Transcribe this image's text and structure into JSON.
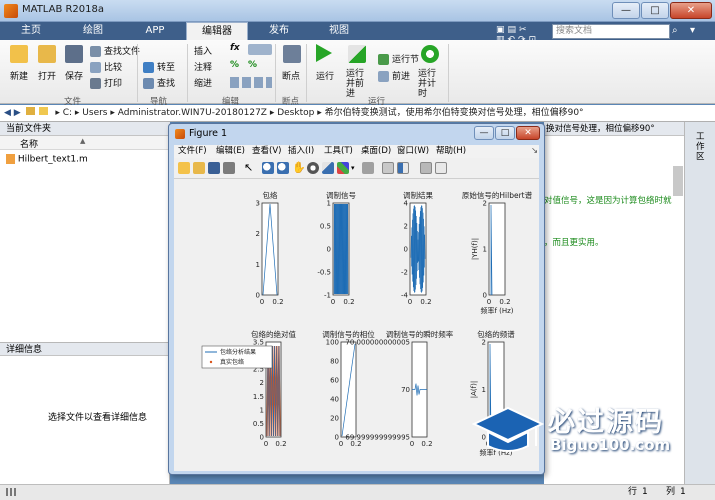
{
  "window": {
    "title": "MATLAB R2018a",
    "controls": [
      "—",
      "□",
      "✕"
    ]
  },
  "ribbon_tabs": [
    "主页",
    "绘图",
    "APP",
    "编辑器",
    "发布",
    "视图"
  ],
  "active_tab": "编辑器",
  "search": {
    "placeholder": "搜索文档"
  },
  "ribbon": {
    "file_buttons": [
      "新建",
      "打开",
      "保存"
    ],
    "file_small": [
      "查找文件",
      "比较",
      "打印"
    ],
    "nav_small": [
      "转至",
      "查找"
    ],
    "edit_small_1": [
      "插入",
      "注释",
      "缩进"
    ],
    "edit_symbols": [
      "fx",
      "%",
      "%"
    ],
    "breakpoint": "断点",
    "run_buttons": [
      "运行",
      "运行并前进",
      "运行节",
      "前进",
      "运行并计时"
    ],
    "groups": [
      "文件",
      "导航",
      "编辑",
      "断点",
      "运行"
    ]
  },
  "address": {
    "path": [
      "C:",
      "Users",
      "Administrator.WIN7U-20180127Z",
      "Desktop",
      "希尔伯特变换测试，使用希尔伯特变换对信号处理，相位偏移90°"
    ]
  },
  "left_panel": {
    "current_folder": "当前文件夹",
    "column_name": "名称",
    "column_sort": "▲",
    "files": [
      "Hilbert_text1.m"
    ],
    "details_header": "详细信息",
    "details_hint": "选择文件以查看详细信息"
  },
  "editor_panel": {
    "title_text": "换对信号处理，相位偏移90°",
    "line1": "对值信号，这是因为计算包络时就",
    "line2": "，而且更实用。",
    "workspace_label": "工作区"
  },
  "status": {
    "row_label": "行",
    "row": "1",
    "col_label": "列",
    "col": "1"
  },
  "figure": {
    "title": "Figure 1",
    "menu": [
      "文件(F)",
      "编辑(E)",
      "查看(V)",
      "插入(I)",
      "工具(T)",
      "桌面(D)",
      "窗口(W)",
      "帮助(H)"
    ],
    "plots": [
      {
        "title": "包络",
        "yticks": [
          "3",
          "2",
          "1",
          "0"
        ],
        "xticks": [
          "0",
          "0.2"
        ]
      },
      {
        "title": "调制信号",
        "yticks": [
          "1",
          "0.5",
          "0",
          "-0.5",
          "-1"
        ],
        "xticks": [
          "0",
          "0.2"
        ]
      },
      {
        "title": "调制结果",
        "yticks": [
          "4",
          "2",
          "0",
          "-2",
          "-4"
        ],
        "xticks": [
          "0",
          "0.2"
        ]
      },
      {
        "title": "原始信号的Hilbert谱",
        "yticks": [
          "2",
          "1",
          "0"
        ],
        "xticks": [
          "0",
          "0.2"
        ],
        "ylabel": "|YH(f)|",
        "xlabel": "频率f (Hz)"
      },
      {
        "title": "包络的绝对值",
        "yticks": [
          "3.5",
          "3",
          "2.5",
          "2",
          "1.5",
          "1",
          "0.5",
          "0"
        ],
        "xticks": [
          "0",
          "0.2"
        ]
      },
      {
        "title": "调制信号的相位",
        "yticks": [
          "100",
          "80",
          "60",
          "40",
          "20",
          "0"
        ],
        "xticks": [
          "0",
          "0.2"
        ]
      },
      {
        "title": "调制信号的瞬时频率",
        "yticks": [
          "70.000000000005",
          "70",
          "69.999999999995"
        ],
        "xticks": [
          "0",
          "0.2"
        ]
      },
      {
        "title": "包络的频谱",
        "yticks": [
          "2",
          "1",
          "0"
        ],
        "xticks": [
          "0",
          "0.2"
        ],
        "ylabel": "|A(f)|",
        "xlabel": "频率f (Hz)"
      }
    ],
    "legend": [
      "包络分析结果",
      "真实包络"
    ]
  },
  "watermark": {
    "title": "必过源码",
    "subtitle": "Biguo100.com"
  },
  "colors": {
    "plot_blue": "#1f6db5",
    "plot_orange": "#d9541a",
    "title_bar": "#b6cde8",
    "tab_bar": "#3e5f8a"
  }
}
